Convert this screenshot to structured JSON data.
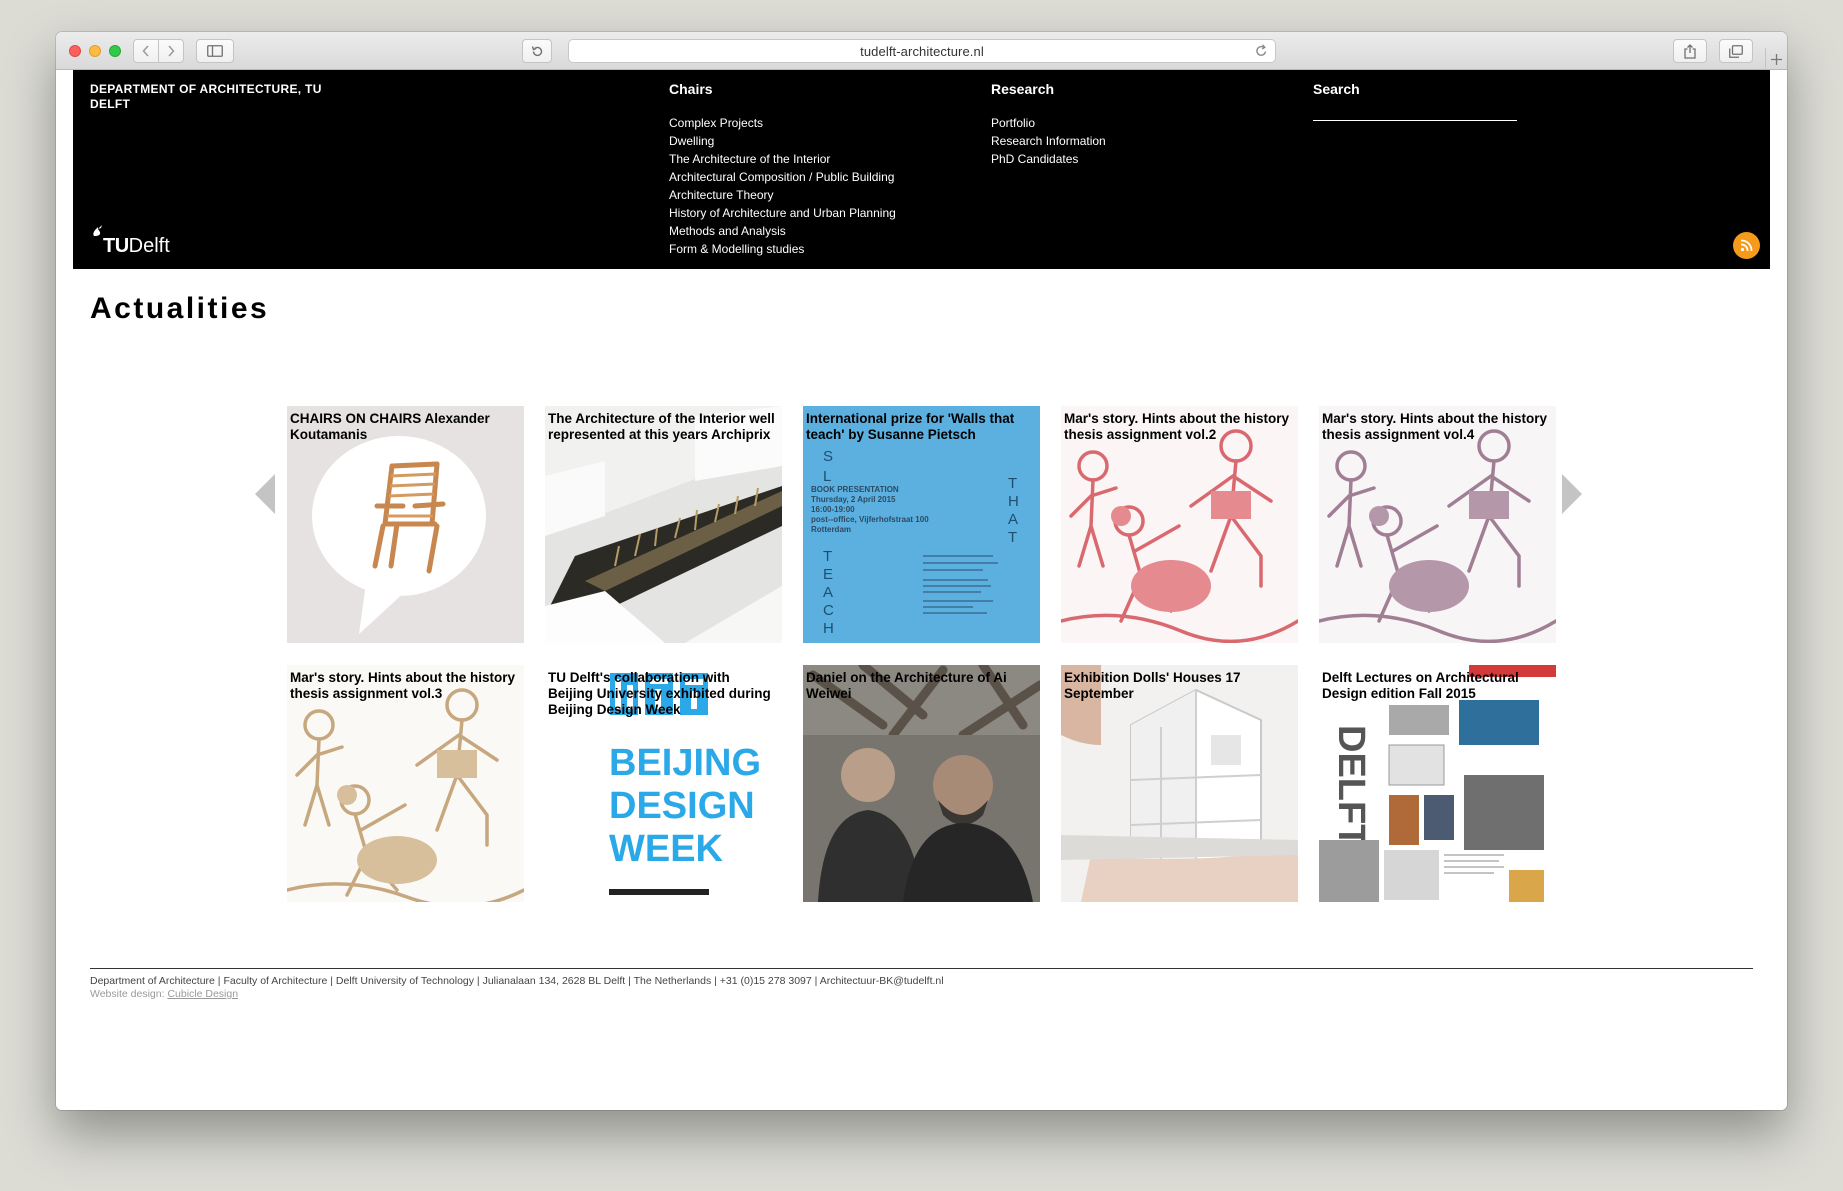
{
  "browser": {
    "url": "tudelft-architecture.nl"
  },
  "header": {
    "department": "DEPARTMENT OF ARCHITECTURE, TU DELFT",
    "logo_tu": "TU",
    "logo_delft": "Delft",
    "chairs": {
      "heading": "Chairs",
      "items": [
        "Complex Projects",
        "Dwelling",
        "The Architecture of the Interior",
        "Architectural Composition / Public Building",
        "Architecture Theory",
        "History of Architecture and Urban Planning",
        "Methods and Analysis",
        "Form & Modelling studies"
      ]
    },
    "research": {
      "heading": "Research",
      "items": [
        "Portfolio",
        "Research Information",
        "PhD Candidates"
      ]
    },
    "search": {
      "heading": "Search"
    },
    "rss_icon": "rss-icon"
  },
  "main": {
    "title": "Actualities",
    "tiles": [
      {
        "caption": "CHAIRS ON CHAIRS Alexander Koutamanis",
        "image": "chair-speech-bubble"
      },
      {
        "caption": "The Architecture of the Interior well represented at this years Archiprix",
        "image": "architectural-model"
      },
      {
        "caption": "International prize for 'Walls that teach' by Susanne Pietsch",
        "image": "blue-book-poster"
      },
      {
        "caption": "Mar's story. Hints about the history thesis assignment vol.2",
        "image": "children-illustration-red"
      },
      {
        "caption": "Mar's story. Hints about the history thesis assignment vol.4",
        "image": "children-illustration-purple"
      },
      {
        "caption": "Mar's story. Hints about the history thesis assignment vol.3",
        "image": "children-illustration-tan"
      },
      {
        "caption": "TU Delft's collaboration with Beijing University exhibited during Beijing Design Week",
        "image": "beijing-design-week-poster"
      },
      {
        "caption": "Daniel on the Architecture of Ai Weiwei",
        "image": "people-photo"
      },
      {
        "caption": "Exhibition Dolls' Houses 17 September",
        "image": "dolls-house-model"
      },
      {
        "caption": "Delft Lectures on Architectural Design edition Fall 2015",
        "image": "lecture-collage"
      }
    ],
    "poster_texts": {
      "book_presentation": "BOOK PRESENTATION",
      "date_line": "Thursday, 2 April 2015",
      "time_line": "16:00-19:00",
      "venue_line": "post--office, Vijferhofstraat 100",
      "city_line": "Rotterdam",
      "beijing": "BEIJING",
      "design": "DESIGN",
      "week": "WEEK",
      "delft": "DELFT"
    }
  },
  "footer": {
    "address": "Department of Architecture | Faculty of Architecture | Delft University of Technology | Julianalaan 134, 2628 BL Delft | The Netherlands | +31 (0)15 278 3097 | Architectuur-BK@tudelft.nl",
    "credit_prefix": "Website design: ",
    "credit_link": "Cubicle Design"
  },
  "colors": {
    "header_bg": "#000000",
    "rss_orange": "#f69a1b",
    "poster_blue": "#5bb0e0",
    "beijing_blue": "#2aa8e8"
  }
}
